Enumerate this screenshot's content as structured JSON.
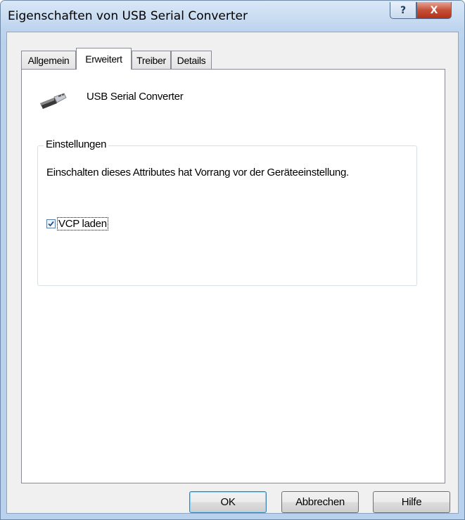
{
  "window": {
    "title": "Eigenschaften von USB Serial Converter",
    "help_glyph": "?",
    "close_glyph": "X"
  },
  "tabs": [
    {
      "label": "Allgemein",
      "active": false
    },
    {
      "label": "Erweitert",
      "active": true
    },
    {
      "label": "Treiber",
      "active": false
    },
    {
      "label": "Details",
      "active": false
    }
  ],
  "panel": {
    "device_name": "USB Serial Converter",
    "icon": "usb-plug-icon",
    "group": {
      "title": "Einstellungen",
      "description": "Einschalten dieses Attributes hat Vorrang vor der Geräteeinstellung.",
      "checkbox": {
        "label": "VCP laden",
        "checked": true
      }
    }
  },
  "buttons": {
    "ok": "OK",
    "cancel": "Abbrechen",
    "help": "Hilfe"
  },
  "colors": {
    "frame": "#b9d1ec",
    "close_button": "#c45038",
    "check_mark": "#2a4f8c"
  }
}
